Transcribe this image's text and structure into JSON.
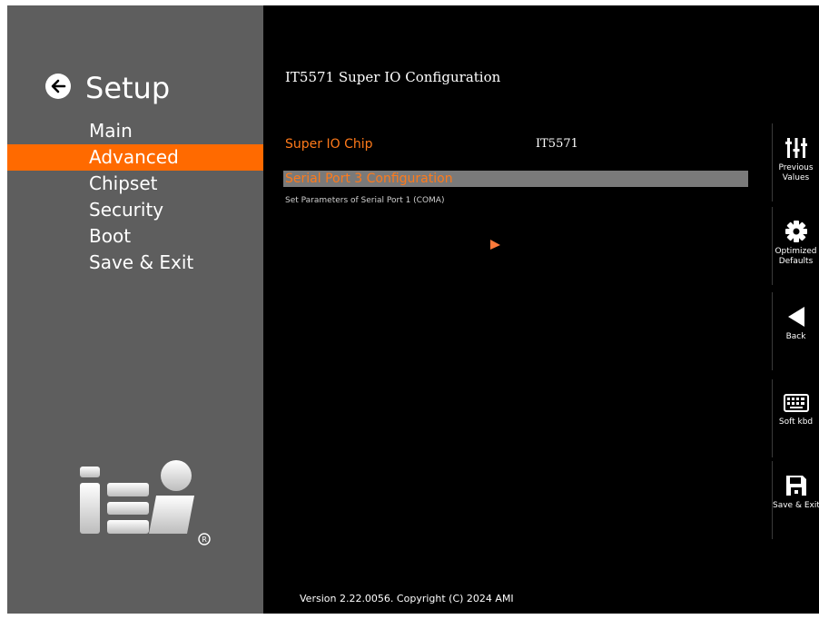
{
  "header": {
    "setup_title": "Setup"
  },
  "menu": {
    "items": [
      {
        "label": "Main"
      },
      {
        "label": "Advanced",
        "active": true
      },
      {
        "label": "Chipset"
      },
      {
        "label": "Security"
      },
      {
        "label": "Boot"
      },
      {
        "label": "Save & Exit"
      }
    ]
  },
  "logo": {
    "text": "iEi",
    "registered": "®"
  },
  "page": {
    "title": "IT5571 Super IO Configuration",
    "rows": [
      {
        "label": "Super IO Chip",
        "value": "IT5571"
      },
      {
        "label": "Serial Port 3 Configuration",
        "selected": true
      }
    ],
    "help": "Set Parameters of Serial Port 1 (COMA)"
  },
  "footer": {
    "version": "Version 2.22.0056. Copyright (C) 2024 AMI"
  },
  "toolbar": {
    "items": [
      {
        "icon": "sliders-icon",
        "label_line1": "Previous",
        "label_line2": "Values"
      },
      {
        "icon": "gear-icon",
        "label_line1": "Optimized",
        "label_line2": "Defaults"
      },
      {
        "icon": "back-triangle-icon",
        "label_line1": "Back",
        "label_line2": ""
      },
      {
        "icon": "keyboard-icon",
        "label_line1": "Soft kbd",
        "label_line2": ""
      },
      {
        "icon": "floppy-disk-icon",
        "label_line1": "Save & Exit",
        "label_line2": ""
      }
    ]
  },
  "colors": {
    "accent": "#ff6a00",
    "left_panel": "#5e5e5e",
    "selection": "#7a7a7a",
    "background": "#000000"
  }
}
